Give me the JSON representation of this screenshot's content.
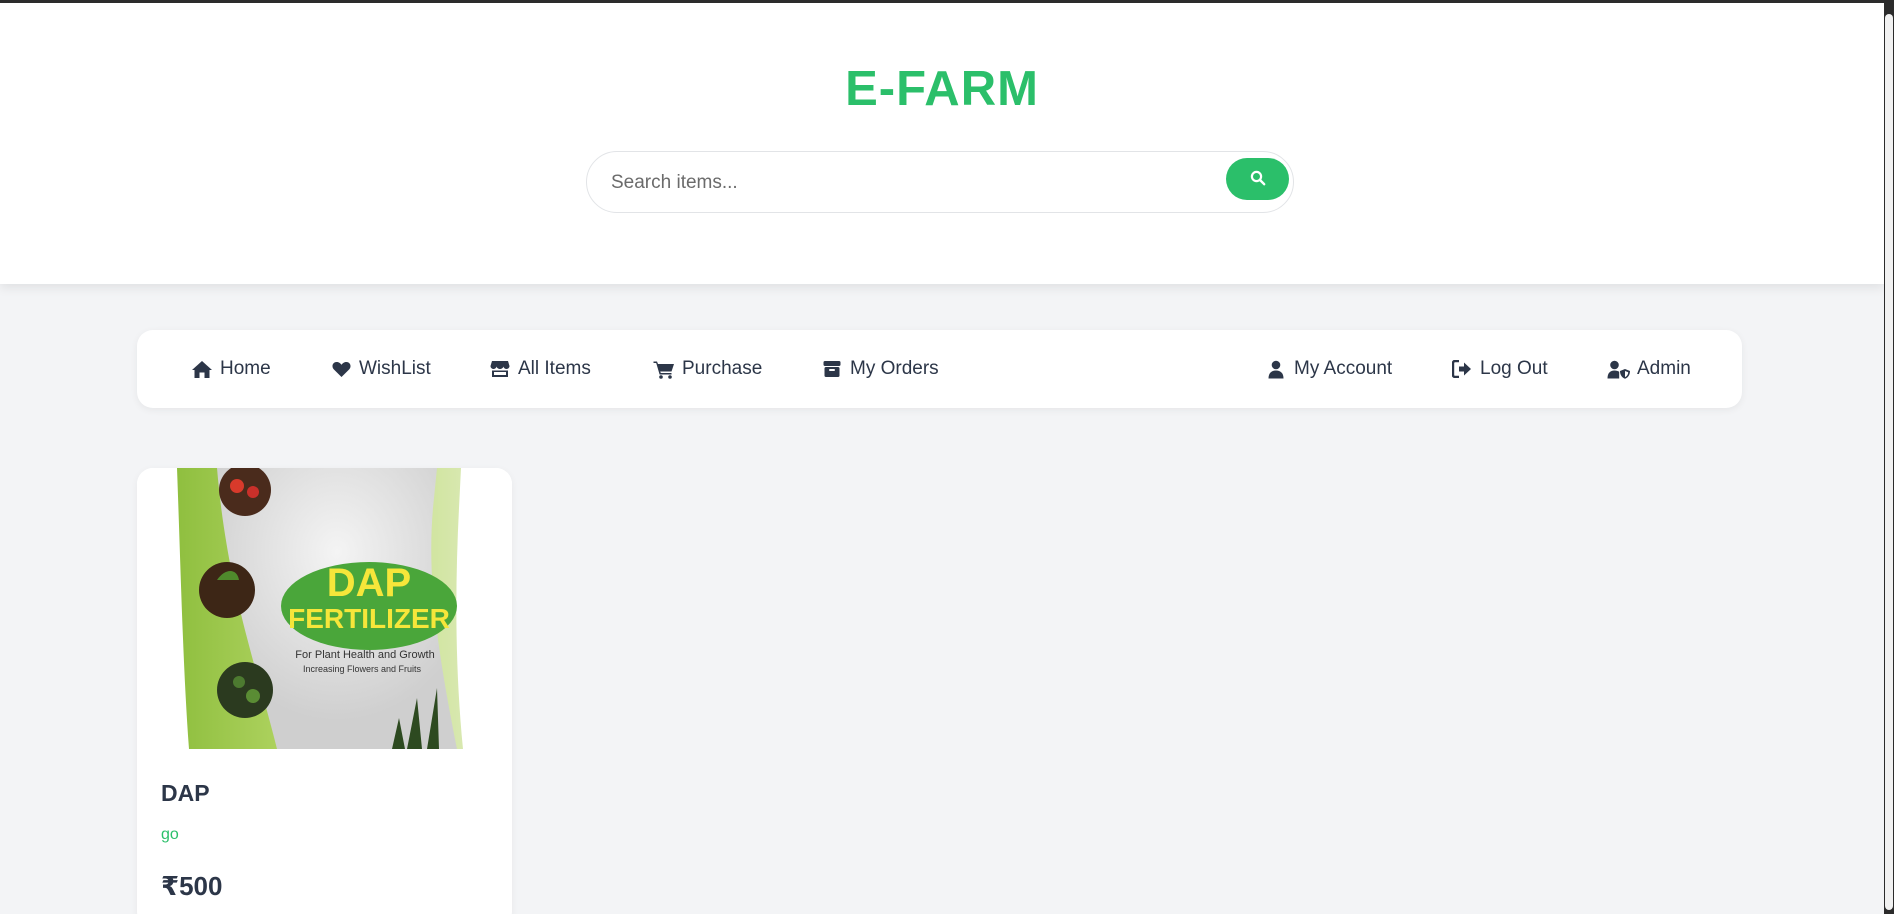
{
  "header": {
    "brand": "E-FARM",
    "search": {
      "placeholder": "Search items...",
      "value": "",
      "button_icon": "search-icon"
    }
  },
  "nav": {
    "left": [
      {
        "label": "Home",
        "icon": "home-icon"
      },
      {
        "label": "WishList",
        "icon": "heart-icon"
      },
      {
        "label": "All Items",
        "icon": "store-icon"
      },
      {
        "label": "Purchase",
        "icon": "cart-icon"
      },
      {
        "label": "My Orders",
        "icon": "box-icon"
      }
    ],
    "right": [
      {
        "label": "My Account",
        "icon": "user-icon"
      },
      {
        "label": "Log Out",
        "icon": "logout-icon"
      },
      {
        "label": "Admin",
        "icon": "user-shield-icon"
      }
    ]
  },
  "products": [
    {
      "name": "DAP",
      "description": "go",
      "price": "₹500",
      "image_text": {
        "line1": "DAP",
        "line2": "FERTILIZER",
        "line3": "For Plant Health and Growth",
        "line4": "Increasing Flowers and Fruits"
      }
    }
  ],
  "colors": {
    "brand": "#2bbf6a",
    "text": "#2c3648",
    "background": "#f3f4f6"
  }
}
